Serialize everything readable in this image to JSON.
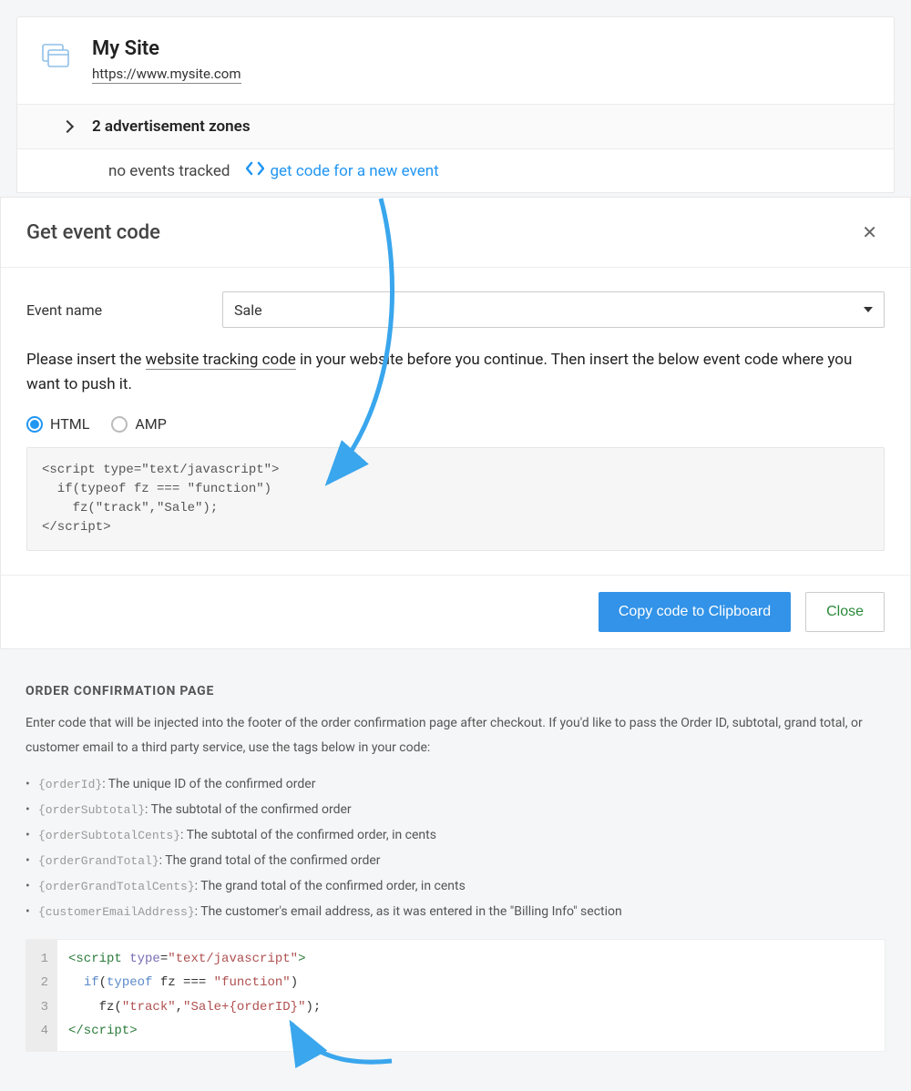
{
  "site": {
    "title": "My Site",
    "url": "https://www.mysite.com"
  },
  "zones": {
    "text": "2 advertisement zones"
  },
  "events": {
    "no_events": "no events tracked",
    "get_code": "get code for a new event"
  },
  "modal": {
    "title": "Get event code",
    "event_name_label": "Event name",
    "event_name_value": "Sale",
    "instruction_prefix": "Please insert the ",
    "instruction_link": "website tracking code",
    "instruction_suffix": " in your website before you continue. Then insert the below event code where you want to push it.",
    "radio_html": "HTML",
    "radio_amp": "AMP",
    "code": "<script type=\"text/javascript\">\n  if(typeof fz === \"function\")\n    fz(\"track\",\"Sale\");\n</scr_ipt>",
    "copy_button": "Copy code to Clipboard",
    "close_button": "Close"
  },
  "doc": {
    "heading": "ORDER CONFIRMATION PAGE",
    "intro": "Enter code that will be injected into the footer of the order confirmation page after checkout. If you'd like to pass the Order ID, subtotal, grand total, or customer email to a third party service, use the tags below in your code:",
    "tags": [
      {
        "code": "{orderId}",
        "desc": ": The unique ID of the confirmed order"
      },
      {
        "code": "{orderSubtotal}",
        "desc": ": The subtotal of the confirmed order"
      },
      {
        "code": "{orderSubtotalCents}",
        "desc": ": The subtotal of the confirmed order, in cents"
      },
      {
        "code": "{orderGrandTotal}",
        "desc": ": The grand total of the confirmed order"
      },
      {
        "code": "{orderGrandTotalCents}",
        "desc": ": The grand total of the confirmed order, in cents"
      },
      {
        "code": "{customerEmailAddress}",
        "desc": ": The customer's email address, as it was entered in the \"Billing Info\" section"
      }
    ],
    "editor_lines": [
      "1",
      "2",
      "3",
      "4"
    ]
  }
}
